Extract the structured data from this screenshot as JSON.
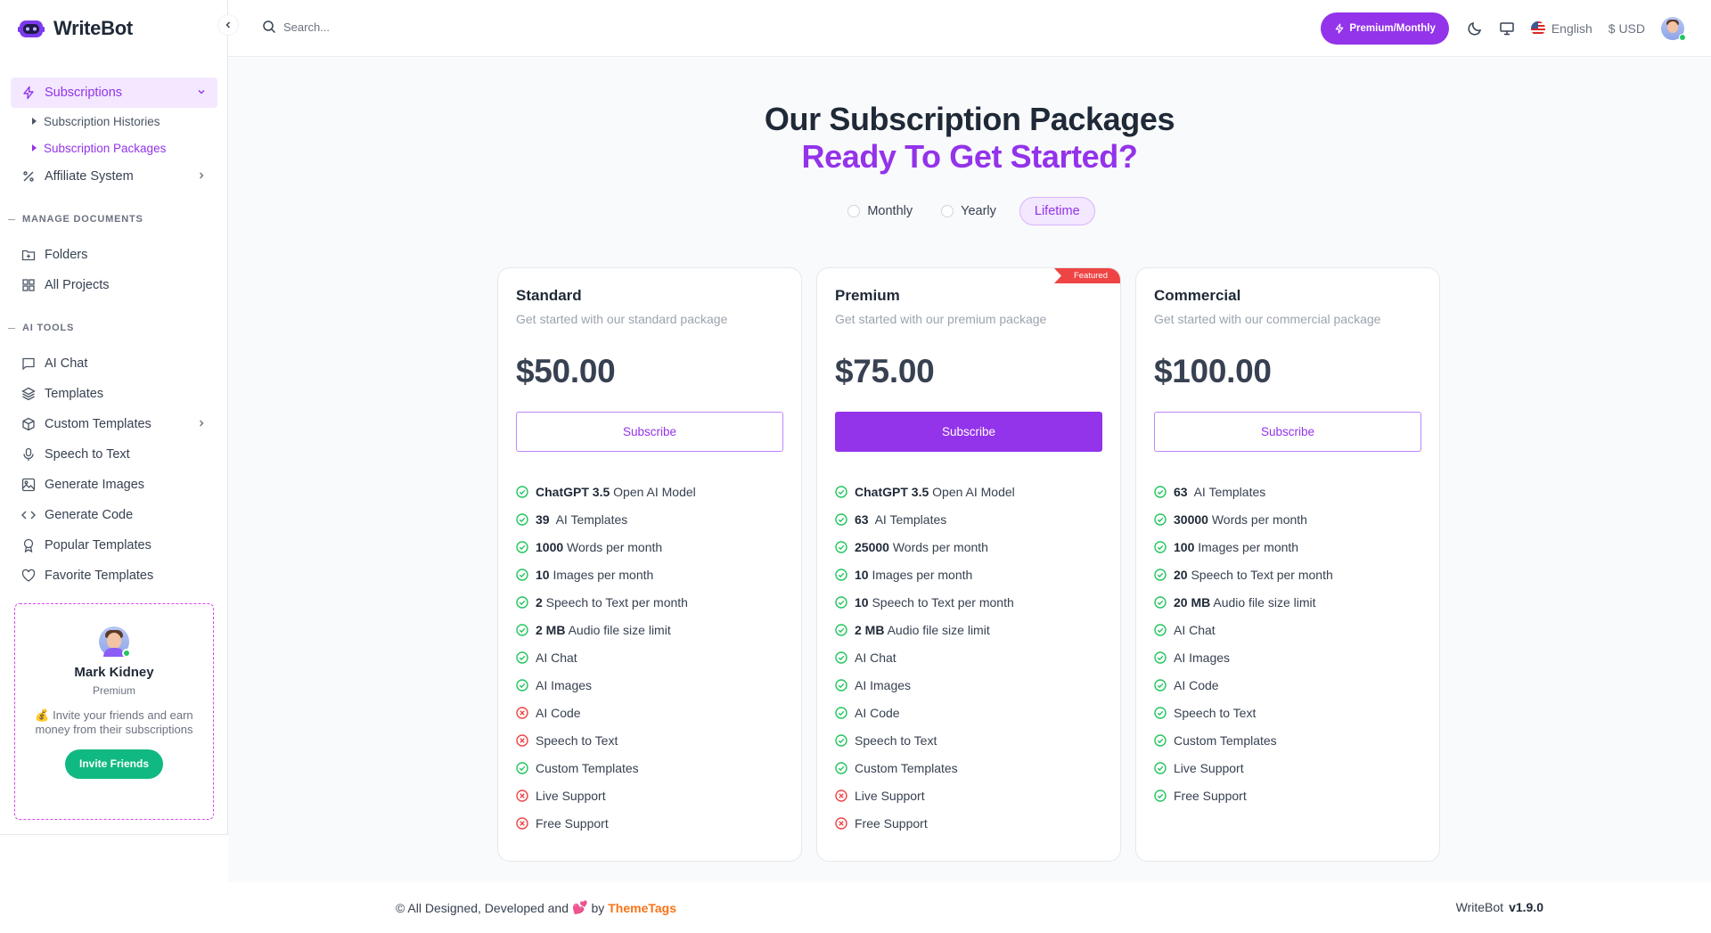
{
  "app": {
    "name": "WriteBot"
  },
  "header": {
    "search_placeholder": "Search...",
    "plan_button": "Premium/Monthly",
    "language": "English",
    "currency": "$ USD"
  },
  "sidebar": {
    "subscriptions": "Subscriptions",
    "subscription_histories": "Subscription Histories",
    "subscription_packages": "Subscription Packages",
    "affiliate": "Affiliate System",
    "manage_documents": "MANAGE DOCUMENTS",
    "folders": "Folders",
    "all_projects": "All Projects",
    "ai_tools": "AI TOOLS",
    "tools": [
      {
        "label": "AI Chat",
        "icon": "chat-icon"
      },
      {
        "label": "Templates",
        "icon": "layers-icon"
      },
      {
        "label": "Custom Templates",
        "icon": "box-icon"
      },
      {
        "label": "Speech to Text",
        "icon": "microphone-icon"
      },
      {
        "label": "Generate Images",
        "icon": "image-icon"
      },
      {
        "label": "Generate Code",
        "icon": "code-icon"
      },
      {
        "label": "Popular Templates",
        "icon": "award-icon"
      },
      {
        "label": "Favorite Templates",
        "icon": "heart-icon"
      }
    ],
    "invite_card": {
      "name": "Mark Kidney",
      "plan": "Premium",
      "text": "💰 Invite your friends and earn money from their subscriptions",
      "button": "Invite Friends"
    }
  },
  "page": {
    "title": "Our Subscription Packages",
    "subtitle": "Ready To Get Started?",
    "billing_options": [
      "Monthly",
      "Yearly",
      "Lifetime"
    ],
    "selected_billing": "Lifetime"
  },
  "packages": [
    {
      "name": "Standard",
      "description": "Get started with our standard package",
      "price": "$50.00",
      "button": "Subscribe",
      "featured": false,
      "features": [
        {
          "bold": "ChatGPT 3.5",
          "text": " Open AI Model",
          "included": true
        },
        {
          "bold": "39",
          "text": "  AI Templates",
          "included": true
        },
        {
          "bold": "1000",
          "text": " Words per month",
          "included": true
        },
        {
          "bold": "10",
          "text": " Images per month",
          "included": true
        },
        {
          "bold": "2",
          "text": " Speech to Text per month",
          "included": true
        },
        {
          "bold": "2 MB",
          "text": " Audio file size limit",
          "included": true
        },
        {
          "bold": "",
          "text": "AI Chat",
          "included": true
        },
        {
          "bold": "",
          "text": "AI Images",
          "included": true
        },
        {
          "bold": "",
          "text": "AI Code",
          "included": false
        },
        {
          "bold": "",
          "text": "Speech to Text",
          "included": false
        },
        {
          "bold": "",
          "text": "Custom Templates",
          "included": true
        },
        {
          "bold": "",
          "text": "Live Support",
          "included": false
        },
        {
          "bold": "",
          "text": "Free Support",
          "included": false
        }
      ]
    },
    {
      "name": "Premium",
      "description": "Get started with our premium package",
      "price": "$75.00",
      "button": "Subscribe",
      "featured": true,
      "featured_label": "Featured",
      "features": [
        {
          "bold": "ChatGPT 3.5",
          "text": " Open AI Model",
          "included": true
        },
        {
          "bold": "63",
          "text": "  AI Templates",
          "included": true
        },
        {
          "bold": "25000",
          "text": " Words per month",
          "included": true
        },
        {
          "bold": "10",
          "text": " Images per month",
          "included": true
        },
        {
          "bold": "10",
          "text": " Speech to Text per month",
          "included": true
        },
        {
          "bold": "2 MB",
          "text": " Audio file size limit",
          "included": true
        },
        {
          "bold": "",
          "text": "AI Chat",
          "included": true
        },
        {
          "bold": "",
          "text": "AI Images",
          "included": true
        },
        {
          "bold": "",
          "text": "AI Code",
          "included": true
        },
        {
          "bold": "",
          "text": "Speech to Text",
          "included": true
        },
        {
          "bold": "",
          "text": "Custom Templates",
          "included": true
        },
        {
          "bold": "",
          "text": "Live Support",
          "included": false
        },
        {
          "bold": "",
          "text": "Free Support",
          "included": false
        }
      ]
    },
    {
      "name": "Commercial",
      "description": "Get started with our commercial package",
      "price": "$100.00",
      "button": "Subscribe",
      "featured": false,
      "features": [
        {
          "bold": "63",
          "text": "  AI Templates",
          "included": true
        },
        {
          "bold": "30000",
          "text": " Words per month",
          "included": true
        },
        {
          "bold": "100",
          "text": " Images per month",
          "included": true
        },
        {
          "bold": "20",
          "text": " Speech to Text per month",
          "included": true
        },
        {
          "bold": "20 MB",
          "text": " Audio file size limit",
          "included": true
        },
        {
          "bold": "",
          "text": "AI Chat",
          "included": true
        },
        {
          "bold": "",
          "text": "AI Images",
          "included": true
        },
        {
          "bold": "",
          "text": "AI Code",
          "included": true
        },
        {
          "bold": "",
          "text": "Speech to Text",
          "included": true
        },
        {
          "bold": "",
          "text": "Custom Templates",
          "included": true
        },
        {
          "bold": "",
          "text": "Live Support",
          "included": true
        },
        {
          "bold": "",
          "text": "Free Support",
          "included": true
        }
      ]
    }
  ],
  "footer": {
    "credit_prefix": "© All Designed, Developed and",
    "credit_heart": "💕",
    "credit_by": "by",
    "credit_brand": "ThemeTags",
    "app_name": "WriteBot",
    "version": "v1.9.0"
  },
  "colors": {
    "primary": "#9333ea",
    "success": "#22c55e",
    "danger": "#ef4444",
    "accent_orange": "#f97316",
    "invite_green": "#10b981"
  }
}
